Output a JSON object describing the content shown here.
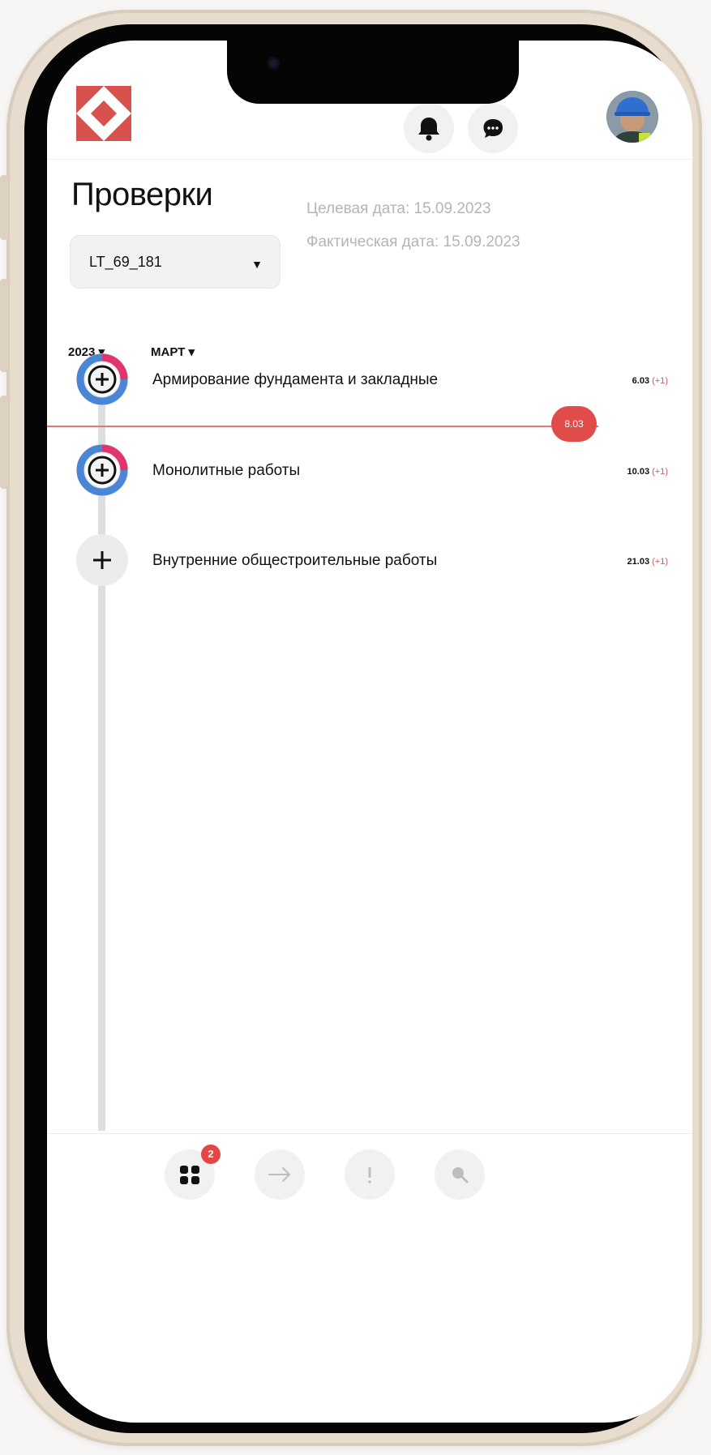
{
  "header": {
    "logo_icon": "brand-logo-icon",
    "bell_icon": "bell-icon",
    "chat_icon": "chat-icon",
    "avatar_icon": "avatar-icon"
  },
  "page": {
    "title": "Проверки",
    "object_select": {
      "value": "LT_69_181",
      "caret_icon": "caret-down-icon"
    },
    "target_date": "Целевая дата: 15.09.2023",
    "actual_date": "Фактическая дата: 15.09.2023",
    "filters": {
      "year": "2023 ▾",
      "month": "МАРТ ▾"
    }
  },
  "timeline": {
    "today_badge": "8.03",
    "items": [
      {
        "title": "Армирование фундамента и закладные",
        "date": "6.03",
        "delta": "(+1)",
        "progress": 0.25,
        "icon": "progress-add-icon"
      },
      {
        "title": "Монолитные работы",
        "date": "10.03",
        "delta": "(+1)",
        "progress": 0.25,
        "icon": "progress-add-icon"
      },
      {
        "title": "Внутренние общестроительные работы",
        "date": "21.03",
        "delta": "(+1)",
        "progress": 0,
        "icon": "add-icon"
      }
    ]
  },
  "bottom_nav": {
    "badge_count": "2",
    "items": [
      {
        "icon": "grid-icon",
        "active": true
      },
      {
        "icon": "arrow-right-icon",
        "active": false
      },
      {
        "icon": "exclamation-icon",
        "active": false
      },
      {
        "icon": "search-icon",
        "active": false
      }
    ]
  },
  "colors": {
    "accent_red": "#e64545",
    "progress_blue": "#4a86d6",
    "progress_pink": "#e0356d"
  }
}
